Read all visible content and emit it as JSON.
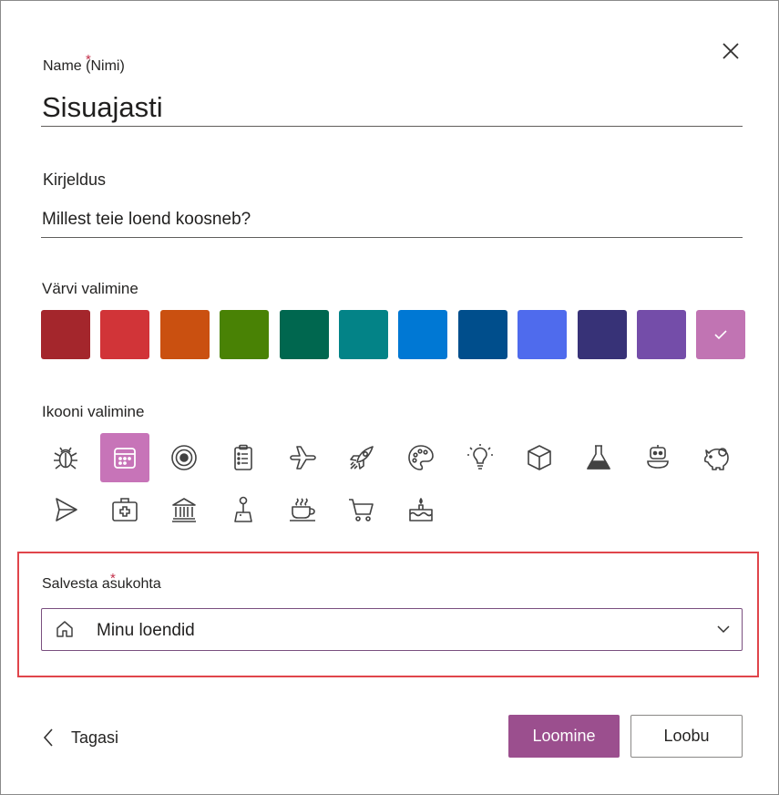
{
  "name_field": {
    "label": "Name (Nimi)",
    "value": "Sisuajasti"
  },
  "description_field": {
    "label": "Kirjeldus",
    "value": "Millest teie loend koosneb?"
  },
  "color_picker": {
    "label": "Värvi valimine",
    "colors": [
      "#a4262c",
      "#d13438",
      "#ca5010",
      "#498205",
      "#00674f",
      "#038387",
      "#0078d4",
      "#004e8c",
      "#4f6bed",
      "#373277",
      "#744da9",
      "#c174b3"
    ],
    "selected_index": 11
  },
  "icon_picker": {
    "label": "Ikooni valimine",
    "icons": [
      "bug-icon",
      "calendar-icon",
      "target-icon",
      "clipboard-list-icon",
      "airplane-icon",
      "rocket-icon",
      "palette-icon",
      "lightbulb-icon",
      "cube-icon",
      "flask-icon",
      "robot-icon",
      "piggy-bank-icon",
      "send-icon",
      "first-aid-kit-icon",
      "bank-icon",
      "joystick-icon",
      "coffee-cup-icon",
      "shopping-cart-icon",
      "cake-icon"
    ],
    "selected_icon": "calendar-icon"
  },
  "save_location": {
    "label": "Salvesta asukohta",
    "value": "Minu loendid",
    "icon": "home-icon"
  },
  "footer": {
    "back_label": "Tagasi",
    "create_label": "Loomine",
    "cancel_label": "Loobu"
  },
  "accent_color": "#9b4f8e",
  "highlight_color": "#e0454b"
}
